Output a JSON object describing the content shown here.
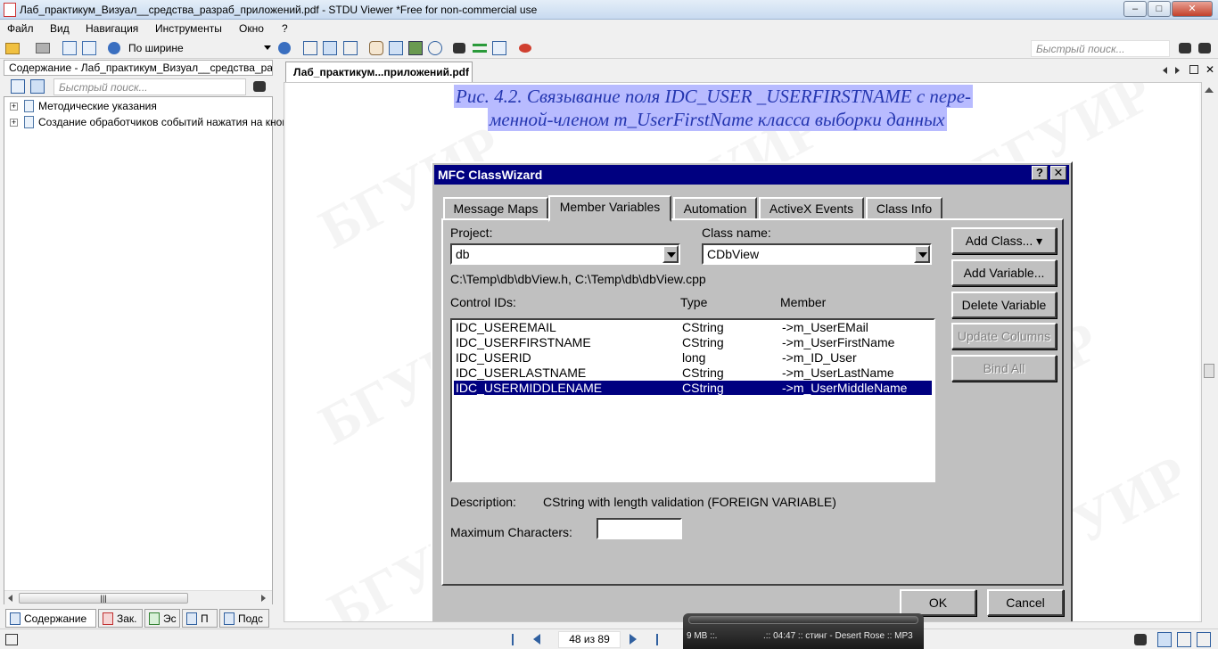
{
  "window": {
    "title": "Лаб_практикум_Визуал__средства_разраб_приложений.pdf - STDU Viewer *Free for non-commercial use",
    "min": "–",
    "max": "□",
    "close": "✕"
  },
  "menu": [
    "Файл",
    "Вид",
    "Навигация",
    "Инструменты",
    "Окно",
    "?"
  ],
  "toolbar": {
    "zoom_value": "По ширине",
    "search_placeholder": "Быстрый поиск..."
  },
  "left_panel": {
    "title": "Содержание - Лаб_практикум_Визуал__средства_разраб_приложений",
    "search_placeholder": "Быстрый поиск...",
    "tree": [
      {
        "label": "Методические указания"
      },
      {
        "label": "Создание обработчиков событий нажатия на кнопки"
      }
    ],
    "tabs": [
      "Содержание",
      "Зак.",
      "Эс",
      "П",
      "Подс"
    ]
  },
  "doc_tab": {
    "label": "Лаб_практикум...приложений.pdf"
  },
  "page": {
    "caption_line1": "Рис. 4.2. Связывание поля IDC_USER _USERFIRSTNAME с пере-",
    "caption_line2": "менной-членом m_UserFirstName класса выборки данных",
    "watermark": "БГУИР"
  },
  "dialog": {
    "title": "MFC ClassWizard",
    "help_btn": "?",
    "close_btn": "✕",
    "tabs": [
      "Message Maps",
      "Member Variables",
      "Automation",
      "ActiveX Events",
      "Class Info"
    ],
    "active_tab": 1,
    "project_label": "Project:",
    "project_value": "db",
    "class_label": "Class name:",
    "class_value": "CDbView",
    "path": "C:\\Temp\\db\\dbView.h, C:\\Temp\\db\\dbView.cpp",
    "columns": [
      "Control IDs:",
      "Type",
      "Member"
    ],
    "rows": [
      {
        "id": "IDC_USEREMAIL",
        "type": "CString",
        "member": "->m_UserEMail"
      },
      {
        "id": "IDC_USERFIRSTNAME",
        "type": "CString",
        "member": "->m_UserFirstName"
      },
      {
        "id": "IDC_USERID",
        "type": "long",
        "member": "->m_ID_User"
      },
      {
        "id": "IDC_USERLASTNAME",
        "type": "CString",
        "member": "->m_UserLastName"
      },
      {
        "id": "IDC_USERMIDDLENAME",
        "type": "CString",
        "member": "->m_UserMiddleName"
      }
    ],
    "selected_row": 4,
    "buttons": {
      "add_class": "Add Class... ▾",
      "add_variable": "Add Variable...",
      "delete_variable": "Delete Variable",
      "update_columns": "Update Columns",
      "bind_all": "Bind All"
    },
    "description_label": "Description:",
    "description_value": "CString with length validation (FOREIGN VARIABLE)",
    "maxchars_label": "Maximum Characters:",
    "maxchars_value": "",
    "ok": "OK",
    "cancel": "Cancel"
  },
  "status": {
    "page_indicator": "48 из 89",
    "media_size": "9 MB ::.",
    "media_track": ".:: 04:47 :: стинг - Desert Rose :: MP3"
  }
}
